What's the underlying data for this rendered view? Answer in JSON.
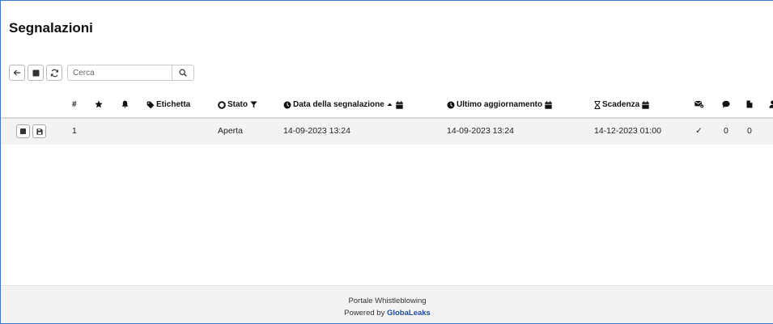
{
  "page": {
    "title": "Segnalazioni"
  },
  "toolbar": {
    "search_placeholder": "Cerca"
  },
  "table": {
    "headers": {
      "number": "#",
      "label": "Etichetta",
      "status": "Stato",
      "date": "Data della segnalazione",
      "updated": "Ultimo aggiornamento",
      "expiry": "Scadenza"
    },
    "rows": [
      {
        "id": "1",
        "status": "Aperta",
        "date": "14-09-2023 13:24",
        "updated": "14-09-2023 13:24",
        "expiry": "14-12-2023 01:00",
        "check": "✓",
        "comments": "0",
        "files": "0"
      }
    ]
  },
  "footer": {
    "title": "Portale Whistleblowing",
    "powered_by": "Powered by",
    "brand": "GlobaLeaks"
  },
  "colors": {
    "accent": "#3a78c9",
    "link": "#1e4fa3",
    "row_bg": "#f3f3f3"
  }
}
